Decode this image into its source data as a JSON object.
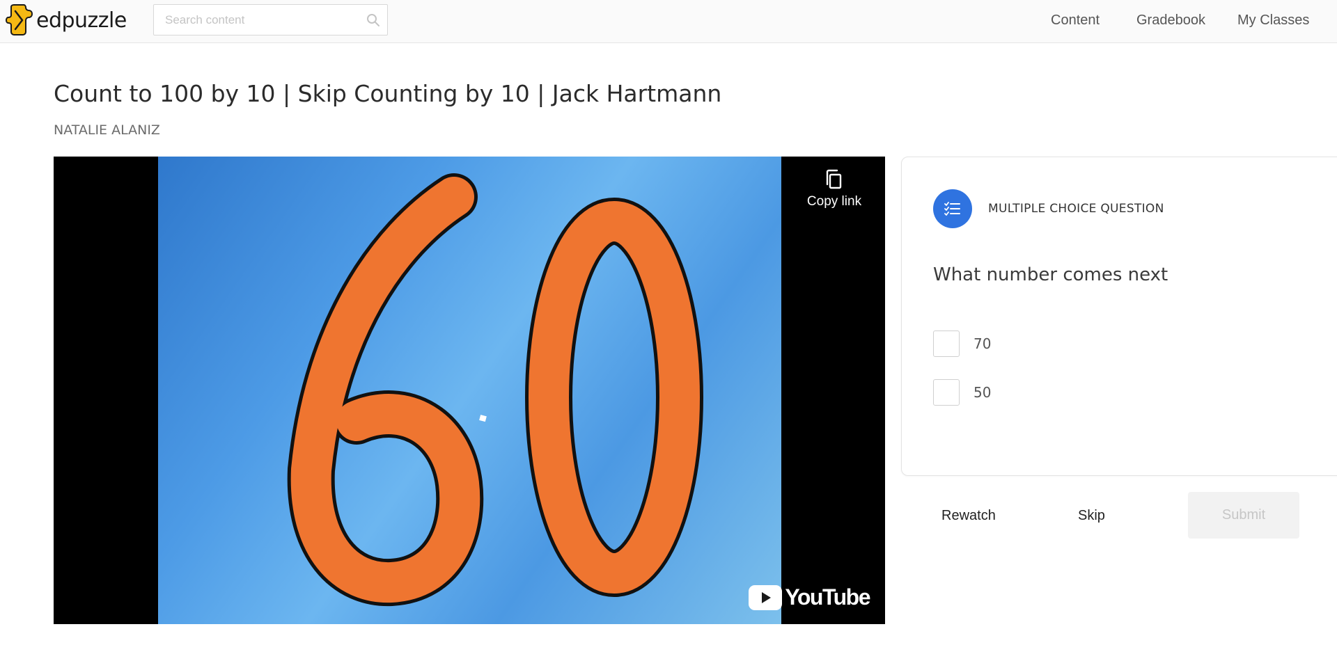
{
  "header": {
    "brand": "edpuzzle",
    "search_placeholder": "Search content",
    "nav": [
      {
        "label": "Content"
      },
      {
        "label": "Gradebook"
      },
      {
        "label": "My Classes"
      }
    ]
  },
  "lesson": {
    "title": "Count to 100 by 10 | Skip Counting by 10 | Jack Hartmann",
    "author": "NATALIE ALANIZ"
  },
  "video": {
    "displayed_number": "60",
    "copy_link_label": "Copy link",
    "platform_label": "YouTube"
  },
  "question": {
    "type_label": "MULTIPLE CHOICE QUESTION",
    "text": "What number comes next",
    "choices": [
      {
        "label": "70",
        "checked": false
      },
      {
        "label": "50",
        "checked": false
      }
    ]
  },
  "actions": {
    "rewatch_label": "Rewatch",
    "skip_label": "Skip",
    "submit_label": "Submit"
  },
  "colors": {
    "accent_blue": "#2f73e0",
    "digit_orange": "#ef7530",
    "video_blue": "#4d9be6"
  }
}
